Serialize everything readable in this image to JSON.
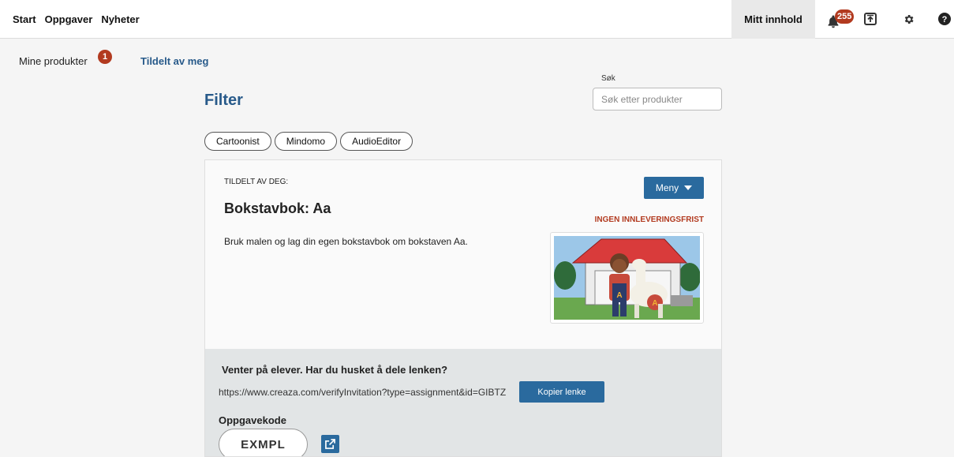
{
  "topnav": {
    "items": [
      {
        "label": "Start"
      },
      {
        "label": "Oppgaver"
      },
      {
        "label": "Nyheter"
      }
    ],
    "mitt_innhold": "Mitt innhold",
    "notifications_count": "255",
    "icons": [
      "bell-icon",
      "upload-icon",
      "gear-icon",
      "help-icon"
    ]
  },
  "subnav": {
    "mine_produkter": "Mine produkter",
    "mine_badge": "1",
    "tildelt_av_meg": "Tildelt av meg"
  },
  "filter": {
    "title": "Filter",
    "search_label": "Søk",
    "search_placeholder": "Søk etter produkter",
    "chips": [
      "Cartoonist",
      "Mindomo",
      "AudioEditor"
    ]
  },
  "assignment": {
    "assigned_label": "TILDELT AV DEG:",
    "menu_label": "Meny",
    "title": "Bokstavbok: Aa",
    "deadline": "INGEN INNLEVERINGSFRIST",
    "description": "Bruk malen og lag din egen bokstavbok om bokstaven Aa.",
    "waiting_text": "Venter på elever. Har du husket å dele lenken?",
    "invite_url": "https://www.creaza.com/verifyInvitation?type=assignment&id=GIBTZ",
    "copy_label": "Kopier lenke",
    "code_label": "Oppgavekode",
    "code": "EXMPL"
  },
  "colors": {
    "accent": "#2a6a9e",
    "link": "#285a8a",
    "badge": "#b23a1f",
    "deadline": "#b23a1f"
  }
}
